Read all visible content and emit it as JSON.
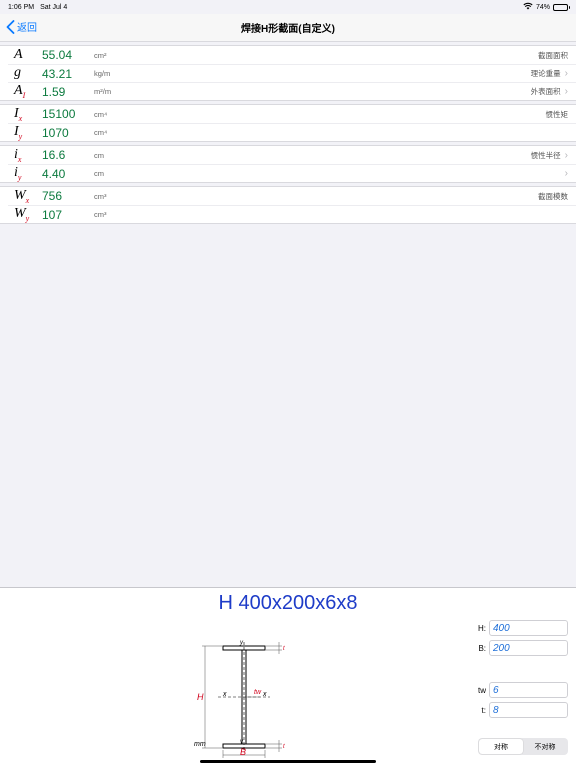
{
  "status": {
    "time": "1:06 PM",
    "date": "Sat Jul 4",
    "battery": "74%",
    "battery_level": 0.74
  },
  "nav": {
    "back": "返回",
    "title": "焊接H形截面(自定义)"
  },
  "groups": [
    {
      "rows": [
        {
          "sym": "A",
          "sub": "",
          "value": "55.04",
          "unit": "cm²",
          "note": "截面面积",
          "chevron": false
        },
        {
          "sym": "g",
          "sub": "",
          "value": "43.21",
          "unit": "kg/m",
          "note": "理论重量",
          "chevron": true
        },
        {
          "sym": "A",
          "sub": "I",
          "value": "1.59",
          "unit": "m²/m",
          "note": "外表面积",
          "chevron": true
        }
      ]
    },
    {
      "rows": [
        {
          "sym": "I",
          "sub": "x",
          "value": "15100",
          "unit": "cm⁴",
          "note": "惯性矩",
          "chevron": false
        },
        {
          "sym": "I",
          "sub": "y",
          "value": "1070",
          "unit": "cm⁴",
          "note": "",
          "chevron": false
        }
      ]
    },
    {
      "rows": [
        {
          "sym": "i",
          "sub": "x",
          "value": "16.6",
          "unit": "cm",
          "note": "惯性半径",
          "chevron": true
        },
        {
          "sym": "i",
          "sub": "y",
          "value": "4.40",
          "unit": "cm",
          "note": "",
          "chevron": true
        }
      ]
    },
    {
      "rows": [
        {
          "sym": "W",
          "sub": "x",
          "value": "756",
          "unit": "cm³",
          "note": "截面模数",
          "chevron": false
        },
        {
          "sym": "W",
          "sub": "y",
          "value": "107",
          "unit": "cm³",
          "note": "",
          "chevron": false
        }
      ]
    }
  ],
  "section": {
    "title": "H 400x200x6x8",
    "unit": "mm",
    "labels": {
      "H": "H",
      "B": "B",
      "tw": "tw",
      "t": "t",
      "x": "x",
      "y": "y"
    },
    "inputs": [
      {
        "label": "H:",
        "value": "400"
      },
      {
        "label": "B:",
        "value": "200"
      },
      {
        "label": "tw",
        "value": "6"
      },
      {
        "label": "t:",
        "value": "8"
      }
    ],
    "segmented": {
      "options": [
        "对称",
        "不对称"
      ],
      "selected": "对称"
    }
  }
}
